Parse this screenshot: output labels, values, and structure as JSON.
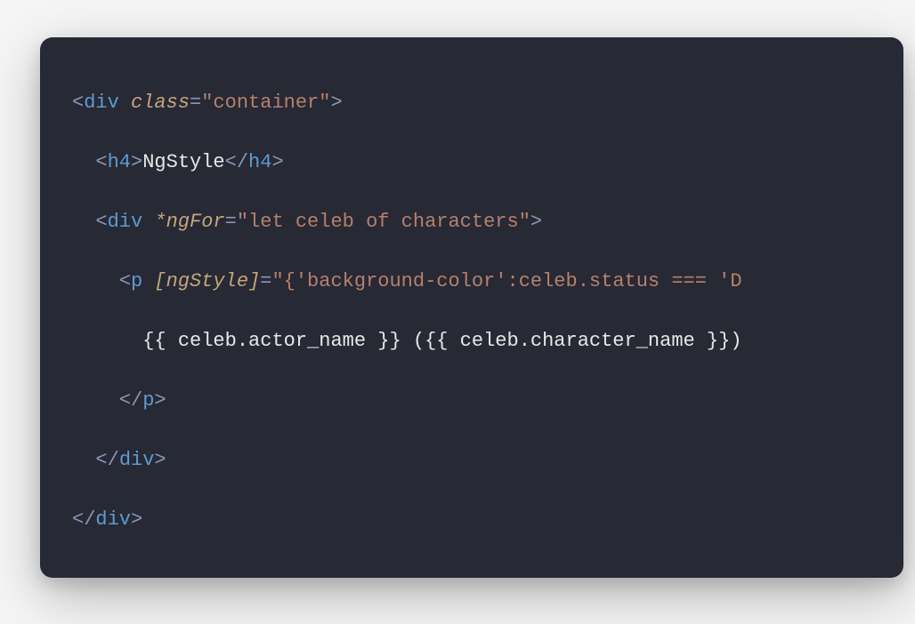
{
  "code": {
    "line1": {
      "open_bracket": "<",
      "tag": "div",
      "attr": "class",
      "equals": "=",
      "string": "\"container\"",
      "close_bracket": ">"
    },
    "line2": {
      "indent": "  ",
      "open_bracket": "<",
      "tag": "h4",
      "close_bracket": ">",
      "text": "NgStyle",
      "close_open": "</",
      "close_tag": "h4",
      "final_bracket": ">"
    },
    "line3": {
      "indent": "  ",
      "open_bracket": "<",
      "tag": "div",
      "attr": "*ngFor",
      "equals": "=",
      "string": "\"let celeb of characters\"",
      "close_bracket": ">"
    },
    "line4": {
      "indent": "    ",
      "open_bracket": "<",
      "tag": "p",
      "attr": "[ngStyle]",
      "equals": "=",
      "string": "\"{'background-color':celeb.status === 'D"
    },
    "line5": {
      "indent": "      ",
      "text": "{{ celeb.actor_name }} ({{ celeb.character_name }})"
    },
    "line6": {
      "indent": "    ",
      "open_bracket": "</",
      "tag": "p",
      "close_bracket": ">"
    },
    "line7": {
      "indent": "  ",
      "open_bracket": "</",
      "tag": "div",
      "close_bracket": ">"
    },
    "line8": {
      "open_bracket": "</",
      "tag": "div",
      "close_bracket": ">"
    }
  }
}
